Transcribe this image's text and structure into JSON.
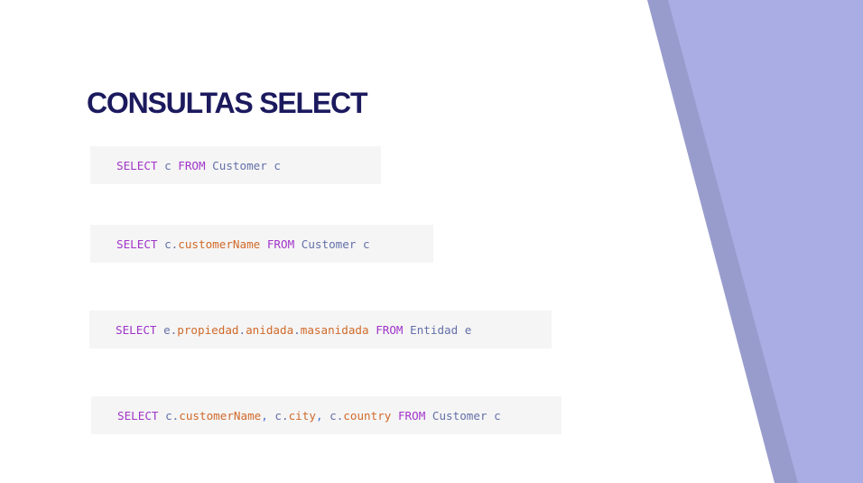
{
  "slide": {
    "title": "CONSULTAS SELECT",
    "colors": {
      "title": "#1c1a5e",
      "accent_light": "#a9ade3",
      "accent_dark": "#989ccd",
      "code_bg": "#f5f5f5",
      "keyword": "#a035c9",
      "identifier": "#6470a8",
      "property": "#d06a2a"
    }
  },
  "queries": [
    {
      "tokens": [
        {
          "t": "SELECT",
          "k": "kw"
        },
        {
          "t": " c ",
          "k": "id"
        },
        {
          "t": "FROM",
          "k": "kw"
        },
        {
          "t": " Customer c",
          "k": "id"
        }
      ]
    },
    {
      "tokens": [
        {
          "t": "SELECT",
          "k": "kw"
        },
        {
          "t": " c.",
          "k": "id"
        },
        {
          "t": "customerName",
          "k": "prop"
        },
        {
          "t": " ",
          "k": "id"
        },
        {
          "t": "FROM",
          "k": "kw"
        },
        {
          "t": " Customer c",
          "k": "id"
        }
      ]
    },
    {
      "tokens": [
        {
          "t": "SELECT",
          "k": "kw"
        },
        {
          "t": " e.",
          "k": "id"
        },
        {
          "t": "propiedad",
          "k": "prop"
        },
        {
          "t": ".",
          "k": "id"
        },
        {
          "t": "anidada",
          "k": "prop"
        },
        {
          "t": ".",
          "k": "id"
        },
        {
          "t": "masanidada",
          "k": "prop"
        },
        {
          "t": " ",
          "k": "id"
        },
        {
          "t": "FROM",
          "k": "kw"
        },
        {
          "t": " Entidad e",
          "k": "id"
        }
      ]
    },
    {
      "tokens": [
        {
          "t": "SELECT",
          "k": "kw"
        },
        {
          "t": " c.",
          "k": "id"
        },
        {
          "t": "customerName",
          "k": "prop"
        },
        {
          "t": ",",
          "k": "comma"
        },
        {
          "t": " c.",
          "k": "id"
        },
        {
          "t": "city",
          "k": "prop"
        },
        {
          "t": ",",
          "k": "comma"
        },
        {
          "t": " c.",
          "k": "id"
        },
        {
          "t": "country",
          "k": "prop"
        },
        {
          "t": " ",
          "k": "id"
        },
        {
          "t": "FROM",
          "k": "kw"
        },
        {
          "t": " Customer c",
          "k": "id"
        }
      ]
    }
  ]
}
